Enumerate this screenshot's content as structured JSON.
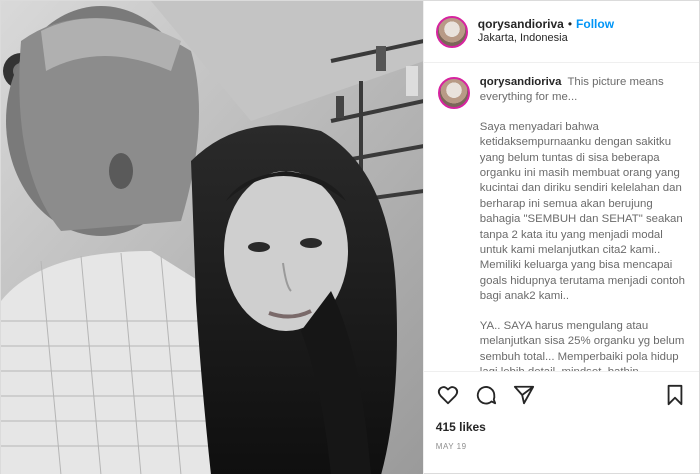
{
  "post": {
    "username": "qorysandioriva",
    "separator": "•",
    "follow_label": "Follow",
    "location": "Jakarta, Indonesia"
  },
  "caption": {
    "username": "qorysandioriva",
    "lead": "This picture means everything for me...",
    "paragraph_1": "Saya menyadari bahwa ketidaksempurnaanku dengan sakitku yang belum tuntas di sisa beberapa organku ini masih membuat orang yang kucintai dan diriku sendiri kelelahan dan berharap ini semua akan berujung bahagia \"SEMBUH dan SEHAT\" seakan tanpa 2 kata itu yang menjadi modal untuk kami melanjutkan cita2 kami.. Memiliki keluarga yang bisa mencapai goals hidupnya terutama menjadi contoh bagi anak2 kami..",
    "paragraph_2": "YA.. SAYA harus mengulang atau melanjutkan sisa 25% organku yg belum sembuh total... Memperbaiki pola hidup lagi lebih detail, mindset, bathin, berobat,"
  },
  "actions": {
    "likes": "415 likes",
    "date": "MAY 19",
    "icons": [
      "heart-icon",
      "comment-icon",
      "share-icon",
      "bookmark-icon"
    ]
  },
  "colors": {
    "follow": "#0095f6",
    "text": "#262626",
    "muted": "#8e8e8e"
  }
}
